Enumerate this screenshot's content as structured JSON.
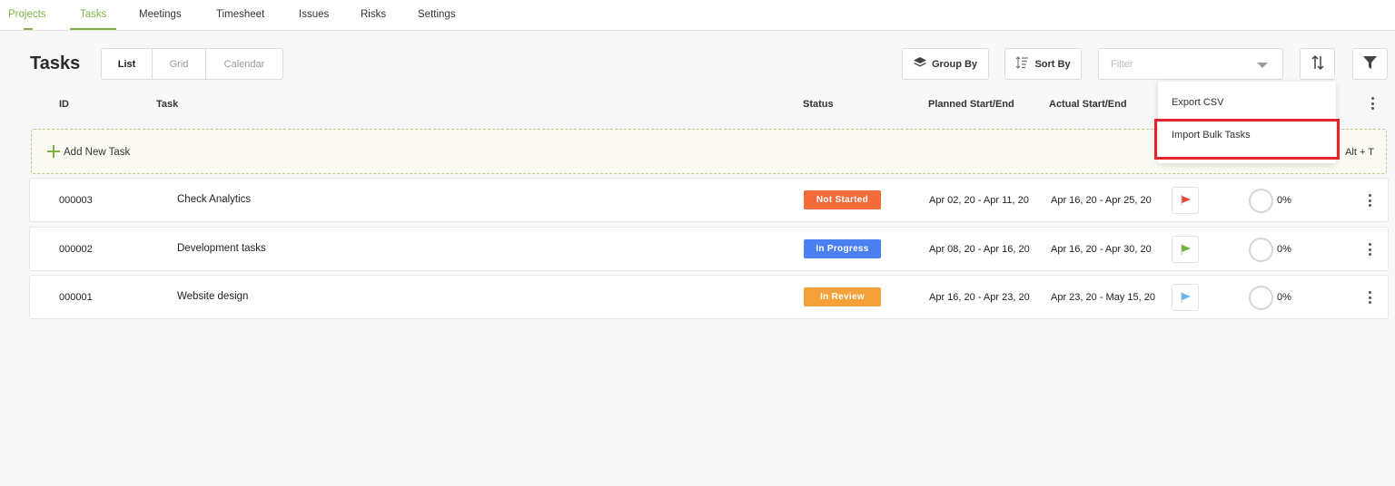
{
  "nav": {
    "items": [
      {
        "label": "Projects"
      },
      {
        "label": "Tasks"
      },
      {
        "label": "Meetings"
      },
      {
        "label": "Timesheet"
      },
      {
        "label": "Issues"
      },
      {
        "label": "Risks"
      },
      {
        "label": "Settings"
      }
    ],
    "active": "Tasks"
  },
  "header": {
    "title": "Tasks",
    "views": [
      "List",
      "Grid",
      "Calendar"
    ],
    "active_view": "List",
    "group_by_label": "Group By",
    "sort_by_label": "Sort By",
    "filter_placeholder": "Filter"
  },
  "columns": {
    "id": "ID",
    "task": "Task",
    "status": "Status",
    "planned": "Planned Start/End",
    "actual": "Actual Start/End"
  },
  "add_task": {
    "label": "Add New Task",
    "shortcut": "Alt + T"
  },
  "tasks": [
    {
      "id": "000003",
      "name": "Check Analytics",
      "status": "Not Started",
      "status_color": "#f26b3a",
      "planned": "Apr 02, 20 - Apr 11, 20",
      "actual": "Apr 16, 20 - Apr 25, 20",
      "priority_color": "#e8453c",
      "progress": "0%"
    },
    {
      "id": "000002",
      "name": "Development tasks",
      "status": "In Progress",
      "status_color": "#4a80ef",
      "planned": "Apr 08, 20 - Apr 16, 20",
      "actual": "Apr 16, 20 - Apr 30, 20",
      "priority_color": "#6fb23a",
      "progress": "0%"
    },
    {
      "id": "000001",
      "name": "Website design",
      "status": "In Review",
      "status_color": "#f4a13a",
      "planned": "Apr 16, 20 - Apr 23, 20",
      "actual": "Apr 23, 20 - May 15, 20",
      "priority_color": "#67b8f0",
      "progress": "0%"
    }
  ],
  "menu": {
    "items": [
      "Export CSV",
      "Import Bulk Tasks"
    ],
    "highlighted": "Import Bulk Tasks"
  },
  "colors": {
    "accent": "#7cb342",
    "highlight": "#e3242b"
  }
}
